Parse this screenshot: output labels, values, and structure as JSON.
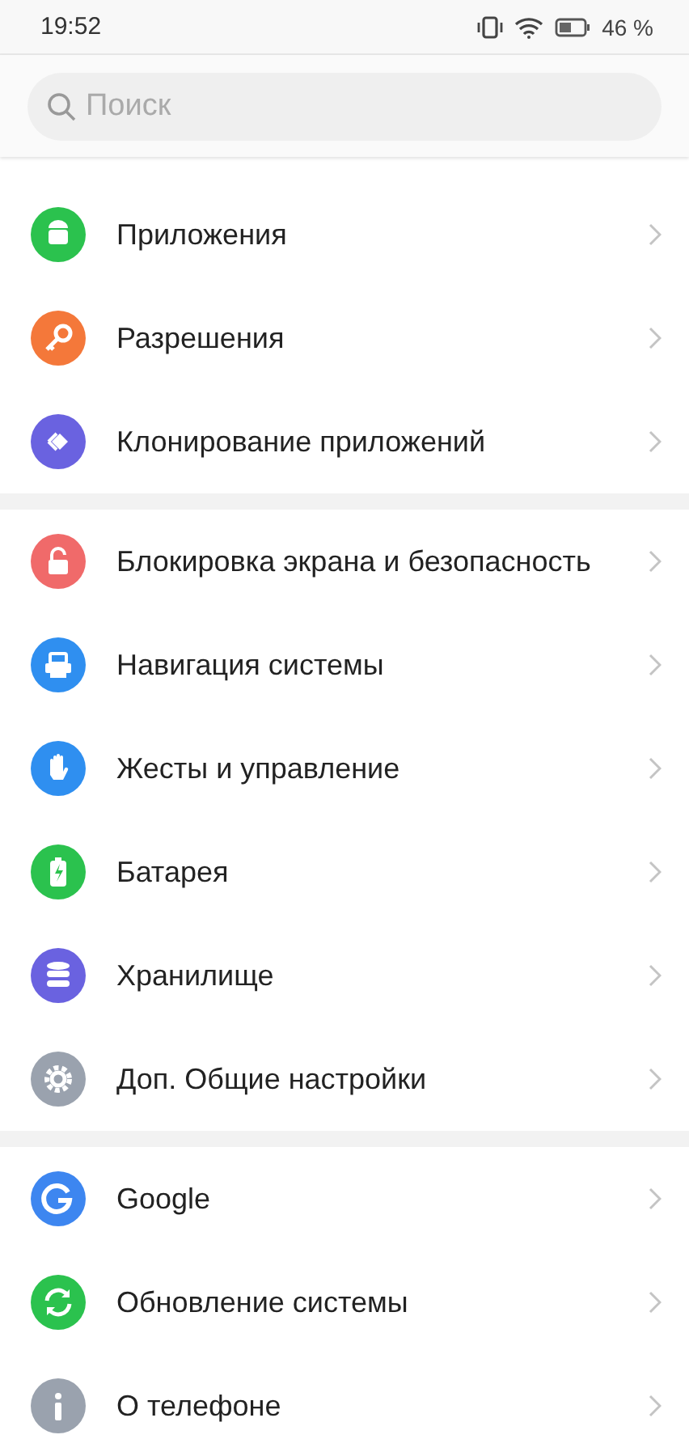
{
  "status_bar": {
    "time": "19:52",
    "battery": "46 %"
  },
  "search": {
    "placeholder": "Поиск"
  },
  "sections": [
    {
      "items": [
        {
          "label": "Приложения",
          "color": "#2bc24e"
        },
        {
          "label": "Разрешения",
          "color": "#f4783a"
        },
        {
          "label": "Клонирование приложений",
          "color": "#6a62e0"
        }
      ]
    },
    {
      "items": [
        {
          "label": "Блокировка экрана и безопасность",
          "color": "#f06a6a"
        },
        {
          "label": "Навигация системы",
          "color": "#2f8ff0"
        },
        {
          "label": "Жесты и управление",
          "color": "#2f8ff0"
        },
        {
          "label": "Батарея",
          "color": "#2bc24e"
        },
        {
          "label": "Хранилище",
          "color": "#6a62e0"
        },
        {
          "label": "Доп. Общие настройки",
          "color": "#9aa2ae"
        }
      ]
    },
    {
      "items": [
        {
          "label": "Google",
          "color": "#3d86f0"
        },
        {
          "label": "Обновление системы",
          "color": "#2bc24e"
        },
        {
          "label": "О телефоне",
          "color": "#9aa2ae"
        }
      ]
    }
  ]
}
